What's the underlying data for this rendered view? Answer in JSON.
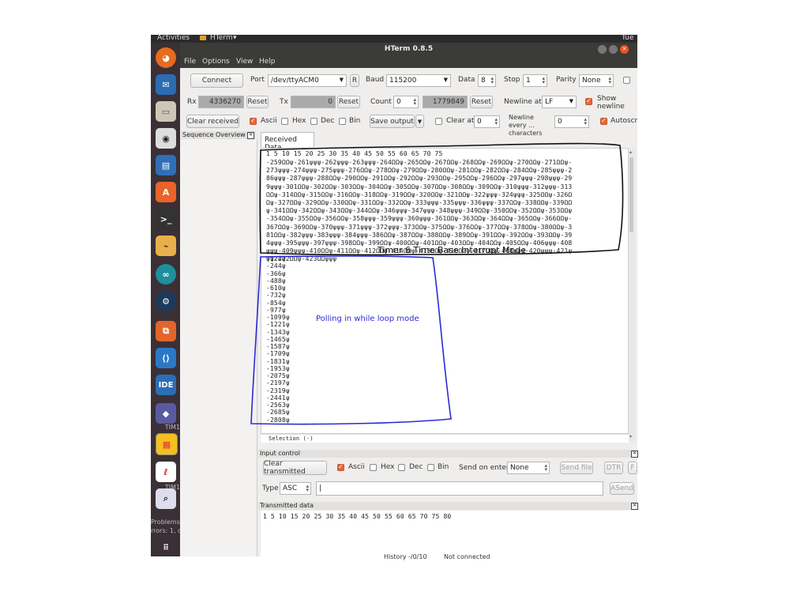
{
  "topbar": {
    "activities": "Activities",
    "app": "HTerm",
    "clock": "Tue"
  },
  "window": {
    "title": "HTerm 0.8.5"
  },
  "menu": [
    "File",
    "Options",
    "View",
    "Help"
  ],
  "connection": {
    "connect_label": "Connect",
    "port_label": "Port",
    "port_value": "/dev/ttyACM0",
    "port_r": "R",
    "baud_label": "Baud",
    "baud_value": "115200",
    "data_label": "Data",
    "data_value": "8",
    "stop_label": "Stop",
    "stop_value": "1",
    "parity_label": "Parity",
    "parity_value": "None"
  },
  "counters": {
    "rx_label": "Rx",
    "rx_value": "4336270",
    "rx_reset": "Reset",
    "tx_label": "Tx",
    "tx_value": "0",
    "tx_reset": "Reset",
    "count_label": "Count",
    "count_value": "0",
    "count_total": "1779849",
    "count_reset": "Reset",
    "newline_at_label": "Newline at",
    "newline_at_value": "LF",
    "show_newline_label": "Show newline"
  },
  "display": {
    "clear_received": "Clear received",
    "ascii": "Ascii",
    "hex": "Hex",
    "dec": "Dec",
    "bin": "Bin",
    "save_output": "Save output",
    "clear_at": "Clear at",
    "clear_at_value": "0",
    "newline_every": "Newline every ... characters",
    "newline_every_value": "0",
    "autoscroll": "Autoscroll"
  },
  "sidebar": {
    "title": "Sequence Overview"
  },
  "received": {
    "tab": "Received Data",
    "ruler": "1    5    10    15    20    25    30    35    40    45    50    55    60    65    70    75",
    "lines": [
      "-259ΩΩψ-261ψψψ-262ψψψ-263ψψψ-264ΩΩψ-265ΩΩψ-267ΩΩψ-268ΩΩψ-269ΩΩψ-270ΩΩψ-271ΩΩψ-",
      "273ψψψ-274ψψψ-275ψψψ-276ΩΩψ-278ΩΩψ-279ΩΩψ-280ΩΩψ-281ΩΩψ-282ΩΩψ-284ΩΩψ-285ψψψ-2",
      "86ψψψ-287ψψψ-288ΩΩψ-290ΩΩψ-291ΩΩψ-292ΩΩψ-293ΩΩψ-295ΩΩψ-296ΩΩψ-297ψψψ-298ψψψ-29",
      "9ψψψ-301ΩΩψ-302ΩΩψ-303ΩΩψ-304ΩΩψ-305ΩΩψ-307ΩΩψ-308ΩΩψ-309ΩΩψ-310ψψψ-312ψψψ-313",
      "ΩΩψ-314ΩΩψ-315ΩΩψ-316ΩΩψ-318ΩΩψ-319ΩΩψ-320ΩΩψ-321ΩΩψ-322ψψψ-324ψψψ-325ΩΩψ-326Ω",
      "Ωψ-327ΩΩψ-329ΩΩψ-330ΩΩψ-331ΩΩψ-332ΩΩψ-333ψψψ-335ψψψ-336ψψψ-337ΩΩψ-338ΩΩψ-339ΩΩ",
      "ψ-341ΩΩψ-342ΩΩψ-343ΩΩψ-344ΩΩψ-346ψψψ-347ψψψ-348ψψψ-349ΩΩψ-350ΩΩψ-352ΩΩψ-353ΩΩψ",
      "-354ΩΩψ-355ΩΩψ-356ΩΩψ-358ψψψ-359ψψψ-360ψψψ-361ΩΩψ-363ΩΩψ-364ΩΩψ-365ΩΩψ-366ΩΩψ-",
      "367ΩΩψ-369ΩΩψ-370ψψψ-371ψψψ-372ψψψ-373ΩΩψ-375ΩΩψ-376ΩΩψ-377ΩΩψ-378ΩΩψ-380ΩΩψ-3",
      "81ΩΩψ-382ψψψ-383ψψψ-384ψψψ-386ΩΩψ-387ΩΩψ-388ΩΩψ-389ΩΩψ-391ΩΩψ-392ΩΩψ-393ΩΩψ-39",
      "4ψψψ-395ψψψ-397ψψψ-398ΩΩψ-399ΩΩψ-400ΩΩψ-401ΩΩψ-403ΩΩψ-404ΩΩψ-405ΩΩψ-406ψψψ-408",
      "ψψψ-409ψψψ-410ΩΩψ-411ΩΩψ-412ΩΩψ-414ΩΩψ-415ΩΩψ-416ΩΩψ-417ΩΩψ-418ψψψ-420ψψψ-421ψ",
      "ψψ-422ΩΩψ-423ΩΩψψψ"
    ],
    "polling_lines": [
      "-122ψ",
      "-244ψ",
      "-366ψ",
      "-488ψ",
      "-610ψ",
      "-732ψ",
      "-854ψ",
      "-977ψ",
      "-1099ψ",
      "-1221ψ",
      "-1343ψ",
      "-1465ψ",
      "-1587ψ",
      "-1709ψ",
      "-1831ψ",
      "-1953ψ",
      "-2075ψ",
      "-2197ψ",
      "-2319ψ",
      "-2441ψ",
      "-2563ψ",
      "-2685ψ",
      "-2808ψ"
    ],
    "selection": "Selection (-)"
  },
  "annotations": {
    "timer_label": "Timer 6 Time Base Interrupt Mode",
    "polling_label": "Polling in while loop mode",
    "timer_color": "#111111",
    "polling_color": "#2b2bd6"
  },
  "input_control": {
    "title": "Input control",
    "clear_transmitted": "Clear transmitted",
    "ascii": "Ascii",
    "hex": "Hex",
    "dec": "Dec",
    "bin": "Bin",
    "send_on_enter_label": "Send on enter",
    "send_on_enter_value": "None",
    "send_file": "Send file",
    "dtr": "DTR",
    "f": "F",
    "type_label": "Type",
    "type_value": "ASC",
    "input_value": "|",
    "asend": "ASend"
  },
  "transmitted": {
    "title": "Transmitted data",
    "ruler": "1    5    10    15    20    25    30    35    40    45    50    55    60    65    70    75    80"
  },
  "status": {
    "history": "History -/0/10",
    "connection": "Not connected"
  },
  "dock_labels": {
    "problems": "Problems",
    "errors": "rrors: 1, c",
    "tim1": "TIM1",
    "tim2": "TIM1"
  }
}
